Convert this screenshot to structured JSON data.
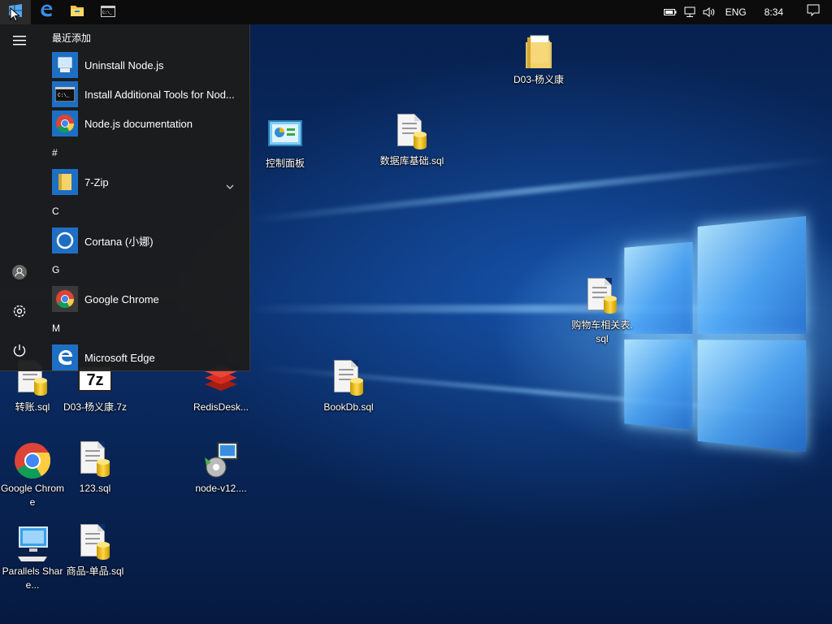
{
  "taskbar": {
    "start_icon": "windows-logo-icon",
    "pinned": [
      {
        "name": "edge-icon"
      },
      {
        "name": "file-explorer-icon"
      },
      {
        "name": "command-prompt-icon"
      }
    ],
    "tray": {
      "icons": [
        "battery-icon",
        "network-icon",
        "volume-icon"
      ],
      "language": "ENG",
      "time": "8:34",
      "notification_icon": "action-center-icon"
    }
  },
  "start_menu": {
    "rail": [
      "hamburger-menu-icon",
      "user-account-icon",
      "settings-icon",
      "power-icon"
    ],
    "recently_added_header": "最近添加",
    "recent": [
      {
        "label": "Uninstall Node.js",
        "icon": "nodejs-uninstall-icon"
      },
      {
        "label": "Install Additional Tools for Nod...",
        "icon": "cmd-console-icon"
      },
      {
        "label": "Node.js documentation",
        "icon": "chrome-icon"
      }
    ],
    "groups": [
      {
        "letter": "#",
        "apps": [
          {
            "label": "7-Zip",
            "icon": "folder-icon",
            "expandable": true
          }
        ]
      },
      {
        "letter": "C",
        "apps": [
          {
            "label": "Cortana (小娜)",
            "icon": "cortana-icon"
          }
        ]
      },
      {
        "letter": "G",
        "apps": [
          {
            "label": "Google Chrome",
            "icon": "chrome-icon"
          }
        ]
      },
      {
        "letter": "M",
        "apps": [
          {
            "label": "Microsoft Edge",
            "icon": "edge-icon"
          }
        ]
      }
    ]
  },
  "desktop": {
    "icons": [
      {
        "label": "D03-杨义康",
        "icon": "folder-icon"
      },
      {
        "label": "控制面板",
        "icon": "control-panel-icon"
      },
      {
        "label": "数据库基础.sql",
        "icon": "sql-file-icon"
      },
      {
        "label": "购物车相关表.sql",
        "icon": "sql-file-icon"
      },
      {
        "label": "转账.sql",
        "icon": "sql-file-icon"
      },
      {
        "label": "D03-杨义康.7z",
        "icon": "7z-archive-icon"
      },
      {
        "label": "RedisDesk...",
        "icon": "redis-desktop-icon"
      },
      {
        "label": "BookDb.sql",
        "icon": "sql-file-icon"
      },
      {
        "label": "Google Chrome",
        "icon": "chrome-icon"
      },
      {
        "label": "123.sql",
        "icon": "sql-file-icon"
      },
      {
        "label": "node-v12....",
        "icon": "installer-package-icon"
      },
      {
        "label": "Parallels Share...",
        "icon": "parallels-shared-icon"
      },
      {
        "label": "商品-单品.sql",
        "icon": "sql-file-icon"
      }
    ]
  }
}
